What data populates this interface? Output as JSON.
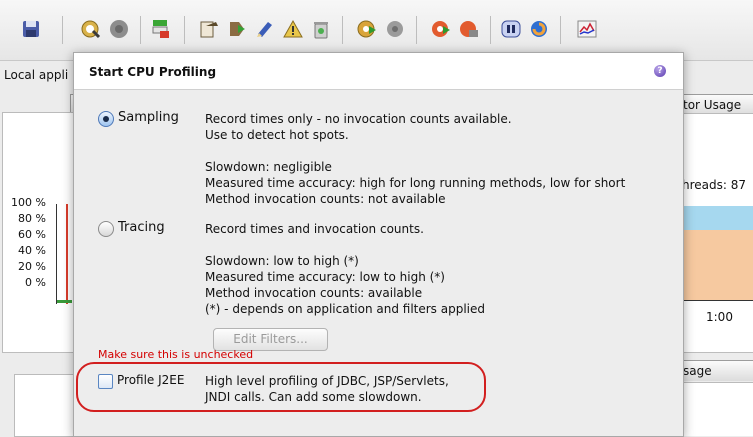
{
  "background": {
    "title_fragment": "Local appli",
    "tab_right_label": "tor Usage",
    "threads_text": "hreads: 87",
    "yticks": [
      "100 %",
      "80 %",
      "60 %",
      "40 %",
      "20 %",
      "0 %"
    ],
    "xtick": "1:00",
    "lower_tab_label": "sage Estima"
  },
  "toolbar": {
    "icons": [
      "save-icon",
      "record-icon",
      "snapshot-icon",
      "filter-icon",
      "export-icon",
      "go-forward-icon",
      "edit-icon",
      "alert-icon",
      "trash-icon",
      "cpu-profile-start-icon",
      "cpu-profile-stop-icon",
      "alloc-start-icon",
      "alloc-stop-icon",
      "pause-icon",
      "refresh-icon",
      "chart-icon"
    ]
  },
  "dialog": {
    "title": "Start CPU Profiling",
    "help_label": "?",
    "options": [
      {
        "label": "Sampling",
        "selected": true,
        "lines": [
          "Record times only - no invocation counts available.",
          "Use to detect hot spots.",
          "",
          "Slowdown: negligible",
          "Measured time accuracy: high for long running methods, low for short",
          "Method invocation counts: not available"
        ]
      },
      {
        "label": "Tracing",
        "selected": false,
        "lines": [
          "Record times and invocation counts.",
          "",
          "Slowdown: low to high (*)",
          "Measured time accuracy: low to high (*)",
          "Method invocation counts: available",
          "(*) - depends on application and filters applied"
        ]
      }
    ],
    "edit_filters_label": "Edit Filters...",
    "warning": "Make sure this is unchecked",
    "j2ee": {
      "label": "Profile J2EE",
      "checked": false,
      "lines": [
        "High level profiling of JDBC, JSP/Servlets,",
        "JNDI calls. Can add some slowdown."
      ]
    }
  },
  "colors": {
    "warning": "#d40000",
    "highlight": "#d21f1f",
    "chart_fill": "#f6c9a0",
    "chart_band": "#a6d8ef"
  }
}
